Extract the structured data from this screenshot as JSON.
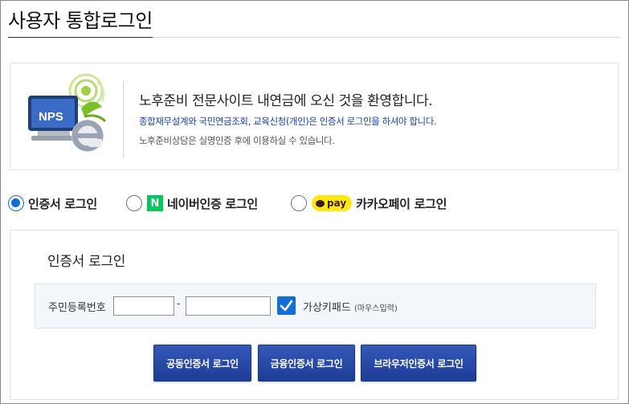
{
  "page": {
    "title": "사용자 통합로그인"
  },
  "welcome": {
    "logo_text": "NPS",
    "heading": "노후준비 전문사이트 내연금에 오신 것을 환영합니다.",
    "notice": "종합재무설계와 국민연금조회, 교육신청(개인)은 인증서 로그인을 하셔야 합니다.",
    "sub": "노후준비상담은 실명인증 후에 이용하실 수 있습니다."
  },
  "login_methods": [
    {
      "label": "인증서 로그인",
      "selected": true
    },
    {
      "label": "네이버인증 로그인",
      "selected": false,
      "badge": "N"
    },
    {
      "label": "카카오페이 로그인",
      "selected": false,
      "badge": "pay"
    }
  ],
  "cert_panel": {
    "title": "인증서 로그인",
    "ssn_label": "주민등록번호",
    "ssn_first_value": "",
    "ssn_second_value": "",
    "separator": "-",
    "virtual_keypad_checked": true,
    "virtual_keypad_label": "가상키패드",
    "virtual_keypad_note": "(마우스입력)",
    "buttons": [
      "공동인증서 로그인",
      "금융인증서 로그인",
      "브라우저인증서 로그인"
    ]
  },
  "colors": {
    "accent": "#0f6fd6",
    "notice_text": "#1a3fa5",
    "button": "#1c3c95",
    "naver": "#03c75a",
    "kakao": "#ffe812"
  }
}
